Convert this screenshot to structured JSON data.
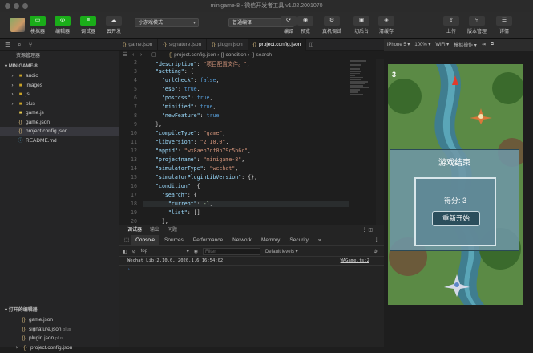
{
  "window": {
    "title": "minigame-8 - 微信开发者工具 v1.02.2001070"
  },
  "toolbar": {
    "buttons": [
      {
        "label": "模拟器",
        "icon": "phone-icon"
      },
      {
        "label": "编辑器",
        "icon": "code-icon"
      },
      {
        "label": "调试器",
        "icon": "debug-icon"
      },
      {
        "label": "云开发",
        "icon": "cloud-icon"
      }
    ],
    "mode_select": "小游戏模式",
    "compile_select": "普通编译",
    "actions": [
      {
        "label": "编译",
        "icon": "compile-icon"
      },
      {
        "label": "预览",
        "icon": "eye-icon"
      },
      {
        "label": "真机调试",
        "icon": "realdevice-icon"
      },
      {
        "label": "切后台",
        "icon": "background-icon"
      },
      {
        "label": "清缓存",
        "icon": "layers-icon"
      }
    ],
    "right": [
      {
        "label": "上传",
        "icon": "upload-icon"
      },
      {
        "label": "版本管理",
        "icon": "branch-icon"
      },
      {
        "label": "详情",
        "icon": "menu-icon"
      }
    ]
  },
  "explorer": {
    "title": "资源管理器",
    "project": "MINIGAME-8",
    "items": [
      {
        "name": "audio",
        "type": "folder"
      },
      {
        "name": "images",
        "type": "folder"
      },
      {
        "name": "js",
        "type": "folder"
      },
      {
        "name": "plus",
        "type": "folder"
      },
      {
        "name": "game.js",
        "type": "js"
      },
      {
        "name": "game.json",
        "type": "json"
      },
      {
        "name": "project.config.json",
        "type": "json"
      },
      {
        "name": "README.md",
        "type": "md"
      }
    ],
    "open_editors_title": "打开的编辑器",
    "open_editors": [
      {
        "name": "game.json",
        "sub": ""
      },
      {
        "name": "signature.json",
        "sub": "plus"
      },
      {
        "name": "plugin.json",
        "sub": "plus"
      },
      {
        "name": "project.config.json",
        "sub": ""
      }
    ]
  },
  "tabs": [
    "game.json",
    "signature.json",
    "plugin.json",
    "project.config.json"
  ],
  "breadcrumb": {
    "file": "project.config.json",
    "b1": "condition",
    "b2": "search"
  },
  "simulator": {
    "device": "iPhone 5",
    "zoom": "100%",
    "network": "WiFi",
    "op": "模拟操作",
    "score_top": "3",
    "gameover_title": "游戏结束",
    "score_text": "得分: 3",
    "restart": "重新开始"
  },
  "console": {
    "tabs1": [
      "调试器",
      "输出",
      "问题"
    ],
    "tabs2": [
      "Console",
      "Sources",
      "Performance",
      "Network",
      "Memory",
      "Security",
      "»"
    ],
    "context": "top",
    "filter_placeholder": "Filter",
    "levels": "Default levels ▾",
    "log": "Wechat Lib:2.10.0, 2020.1.6 16:54:02",
    "source": "WAGame.js:2",
    "prompt": "›"
  }
}
